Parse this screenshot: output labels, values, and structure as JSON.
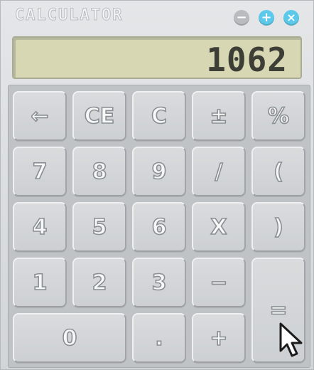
{
  "window": {
    "title": "CALCULATOR",
    "controls": {
      "minimize": "−",
      "maximize": "+",
      "close": "×"
    }
  },
  "display": {
    "value": "1062"
  },
  "keys": {
    "backspace": "←",
    "ce": "CE",
    "c": "C",
    "plusminus": "±",
    "percent": "%",
    "seven": "7",
    "eight": "8",
    "nine": "9",
    "divide": "/",
    "open_paren": "(",
    "four": "4",
    "five": "5",
    "six": "6",
    "multiply": "X",
    "close_paren": ")",
    "one": "1",
    "two": "2",
    "three": "3",
    "minus": "−",
    "equals": "=",
    "zero": "0",
    "dot": ".",
    "plus": "+"
  },
  "colors": {
    "accent": "#5cc8ea",
    "display_bg": "#d7d8b3",
    "display_text": "#3d3e36"
  },
  "icons": {
    "pointer": "mouse-pointer-icon"
  }
}
